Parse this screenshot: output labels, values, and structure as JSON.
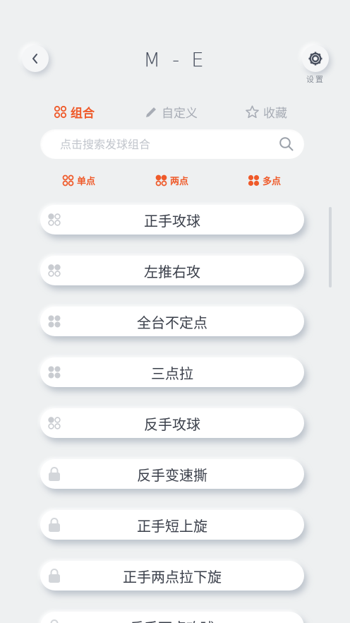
{
  "header": {
    "title": "M - E",
    "settings_label": "设置",
    "back_icon": "chevron-left-icon",
    "settings_icon": "gear-icon"
  },
  "tabs": [
    {
      "label": "组合",
      "icon": "grid-icon",
      "active": true
    },
    {
      "label": "自定义",
      "icon": "pencil-icon",
      "active": false
    },
    {
      "label": "收藏",
      "icon": "star-icon",
      "active": false
    }
  ],
  "search": {
    "placeholder": "点击搜索发球组合",
    "icon": "search-icon"
  },
  "filters": [
    {
      "label": "单点",
      "icon": "one-point-icon"
    },
    {
      "label": "两点",
      "icon": "two-point-icon"
    },
    {
      "label": "多点",
      "icon": "multi-point-icon"
    }
  ],
  "items": [
    {
      "label": "正手攻球",
      "icon": "one-point-icon",
      "locked": false
    },
    {
      "label": "左推右攻",
      "icon": "two-point-icon",
      "locked": false
    },
    {
      "label": "全台不定点",
      "icon": "multi-point-icon",
      "locked": false
    },
    {
      "label": "三点拉",
      "icon": "multi-point-icon",
      "locked": false
    },
    {
      "label": "反手攻球",
      "icon": "one-point-icon",
      "locked": false
    },
    {
      "label": "反手变速撕",
      "icon": "lock-icon",
      "locked": true
    },
    {
      "label": "正手短上旋",
      "icon": "lock-icon",
      "locked": true
    },
    {
      "label": "正手两点拉下旋",
      "icon": "lock-icon",
      "locked": true
    },
    {
      "label": "反手两点攻球",
      "icon": "lock-icon",
      "locked": true
    }
  ],
  "colors": {
    "accent": "#ef5a2a",
    "inactive": "#a7acb5",
    "background": "#eef0f1"
  }
}
